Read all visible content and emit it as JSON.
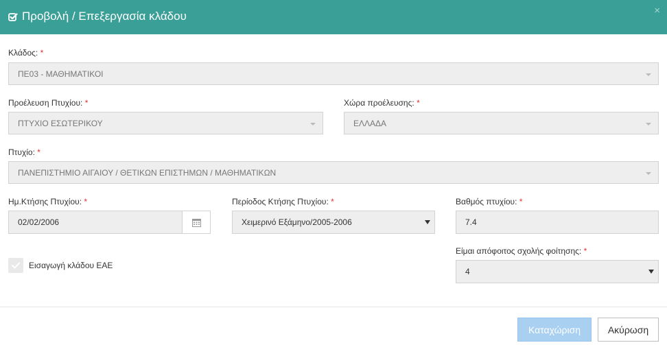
{
  "header": {
    "title": "Προβολή / Επεξεργασία κλάδου",
    "close": "×"
  },
  "form": {
    "required_mark": "*",
    "klados": {
      "label": "Κλάδος:",
      "value": "ΠΕ03 - ΜΑΘΗΜΑΤΙΚΟΙ"
    },
    "proeleusi": {
      "label": "Προέλευση Πτυχίου:",
      "value": "ΠΤΥΧΙΟ ΕΣΩΤΕΡΙΚΟΥ"
    },
    "xwra": {
      "label": "Χώρα προέλευσης:",
      "value": "ΕΛΛΑΔΑ"
    },
    "ptyxio": {
      "label": "Πτυχίο:",
      "value": "ΠΑΝΕΠΙΣΤΗΜΙΟ ΑΙΓΑΙΟΥ / ΘΕΤΙΚΩΝ ΕΠΙΣΤΗΜΩΝ / ΜΑΘΗΜΑΤΙΚΩΝ"
    },
    "date": {
      "label": "Ημ.Κτήσης Πτυχίου:",
      "value": "02/02/2006"
    },
    "period": {
      "label": "Περίοδος Κτήσης Πτυχίου:",
      "value": "Χειμερινό Εξάμηνο/2005-2006"
    },
    "grade": {
      "label": "Βαθμός πτυχίου:",
      "value": "7.4"
    },
    "graduate": {
      "label": "Είμαι απόφοιτος σχολής φοίτησης:",
      "value": "4"
    },
    "eae_checkbox": {
      "label": "Εισαγωγή κλάδου ΕΑΕ",
      "checked": true
    }
  },
  "footer": {
    "save_label": "Καταχώριση",
    "cancel_label": "Ακύρωση"
  },
  "colors": {
    "header_bg": "#3a9f97",
    "save_bg": "#a9d0f1",
    "required": "#e0312f"
  }
}
